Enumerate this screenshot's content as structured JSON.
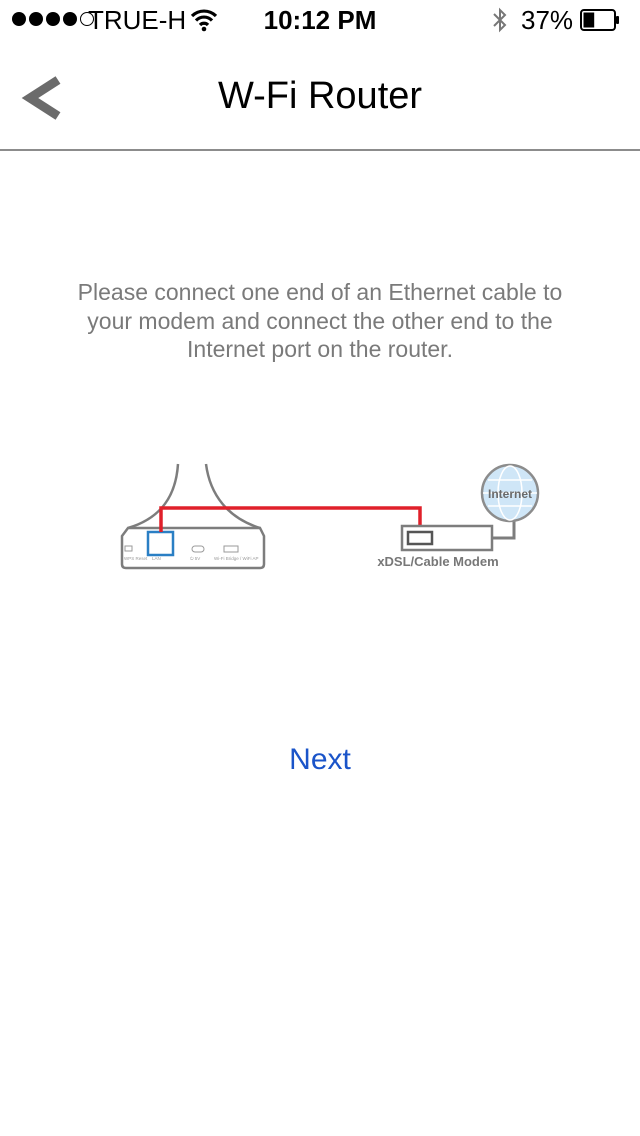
{
  "status_bar": {
    "carrier": "TRUE-H",
    "time": "10:12 PM",
    "battery_percent": "37%",
    "battery_level": 0.37,
    "signal_bars_filled": 4,
    "signal_bars_total": 5,
    "icons": [
      "signal-dots-icon",
      "wifi-icon",
      "bluetooth-icon",
      "battery-icon"
    ]
  },
  "nav": {
    "title": "W-Fi Router",
    "back_icon": "chevron-left-icon"
  },
  "instruction": {
    "text": "Please connect one end of an Ethernet cable to your modem and connect the other end to the Internet port on the router."
  },
  "diagram": {
    "modem_label": "xDSL/Cable Modem",
    "internet_label": "Internet",
    "colors": {
      "cable": "#e0202a",
      "port_highlight": "#2a7fc4",
      "globe": "#cfe6f7"
    }
  },
  "actions": {
    "next_label": "Next"
  },
  "colors": {
    "link": "#1a54c9",
    "instruction_text": "#7a7a7a",
    "divider": "#8c8c8c"
  }
}
